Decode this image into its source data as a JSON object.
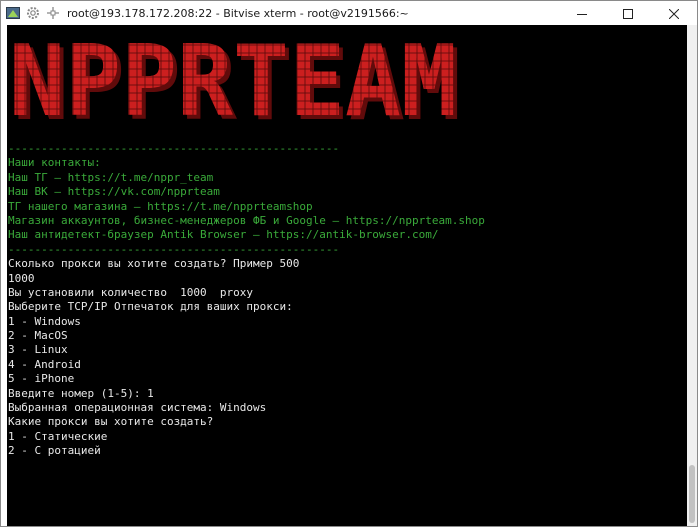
{
  "window": {
    "title": "root@193.178.172.208:22 - Bitvise xterm - root@v2191566:~",
    "icons": [
      "bitvise-app-icon",
      "gear-icon",
      "move-icon"
    ],
    "controls": [
      "minimize-icon",
      "maximize-icon",
      "close-icon"
    ]
  },
  "banner": {
    "text": "NPPRTEAM",
    "color": "#cc1f1f",
    "shadow_color": "#8a1010"
  },
  "terminal": {
    "divider": "--------------------------------------------------",
    "contacts": [
      "Наши контакты:",
      "Наш ТГ — https://t.me/nppr_team",
      "Наш ВК — https://vk.com/npprteam",
      "ТГ нашего магазина — https://t.me/npprteamshop",
      "Магазин аккаунтов, бизнес-менеджеров ФБ и Google — https://npprteam.shop",
      "Наш антидетект-браузер Antik Browser — https://antik-browser.com/"
    ],
    "session": [
      "Сколько прокси вы хотите создать? Пример 500",
      "1000",
      "Вы установили количество  1000  proxy",
      "Выберите TCP/IP Отпечаток для ваших прокси:",
      "1 - Windows",
      "2 - MacOS",
      "3 - Linux",
      "4 - Android",
      "5 - iPhone",
      "Введите номер (1-5): 1",
      "Выбранная операционная система: Windows",
      "Какие прокси вы хотите создать?",
      "1 - Статические",
      "2 - С ротацией"
    ]
  },
  "colors": {
    "terminal_bg": "#000000",
    "text_green": "#3aaa3a",
    "text_white": "#e8e8e8"
  }
}
